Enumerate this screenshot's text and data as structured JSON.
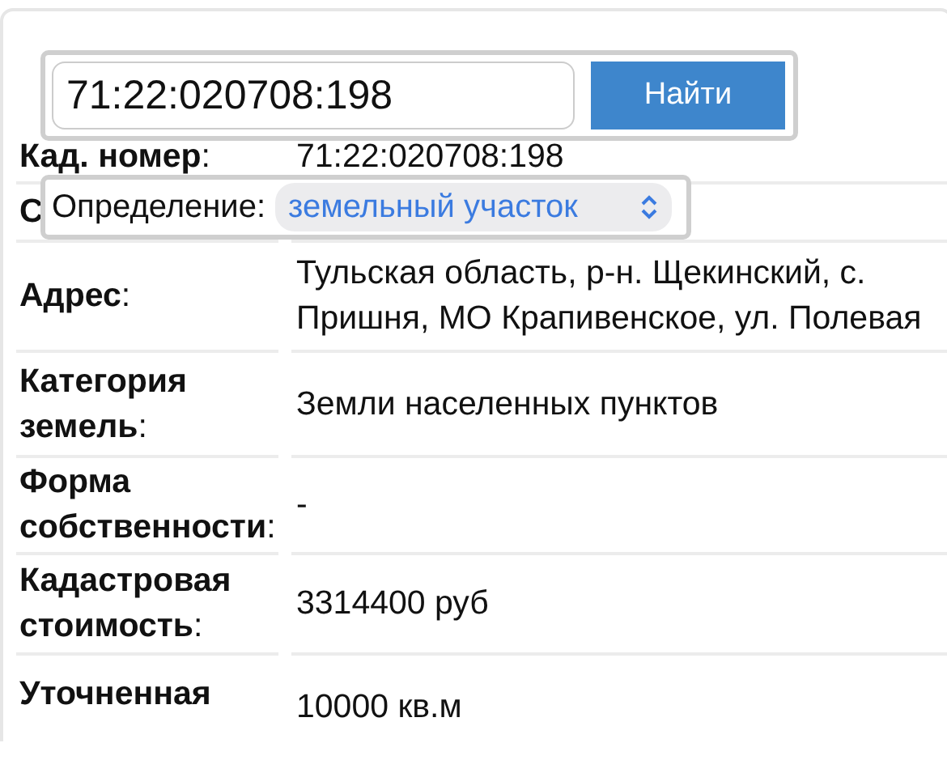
{
  "search": {
    "value": "71:22:020708:198",
    "button": "Найти"
  },
  "definition": {
    "label": "Определение:",
    "value": "земельный участок"
  },
  "rows": [
    {
      "label": "**Кад. номер**:",
      "value": "71:22:020708:198"
    },
    {
      "label": "**С**",
      "value": null
    },
    {
      "label": "**Адрес**:",
      "value": "Тульская область, р-н. Щекинский, с. Пришня, МО Крапивенское, ул. Полевая"
    },
    {
      "label": "**Категория земель**:",
      "value": "Земли населенных пунктов"
    },
    {
      "label": "**Форма собственности**:",
      "value": "-"
    },
    {
      "label": "**Кадастровая стоимость**:",
      "value": "3314400 руб"
    },
    {
      "label": "**Уточненная**",
      "value": "10000 кв.м"
    }
  ]
}
